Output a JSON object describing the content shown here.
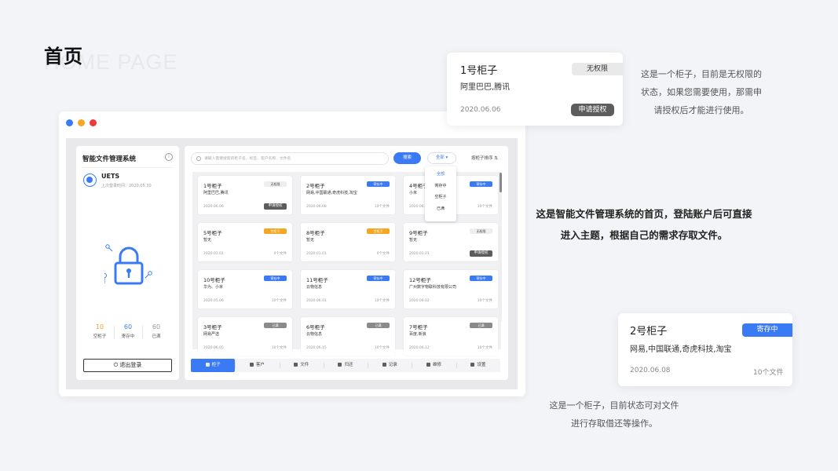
{
  "header": {
    "title": "首页",
    "watermark": "HOME PAGE"
  },
  "sidebar": {
    "app_title": "智能文件管理系统",
    "user": "UETS",
    "last_login": "上次登录时间：2020.05.30",
    "stats": [
      {
        "value": "10",
        "label": "空柜子",
        "color": "#f5a623"
      },
      {
        "value": "60",
        "label": "寄存中",
        "color": "#3a7bf5"
      },
      {
        "value": "60",
        "label": "已满",
        "color": "#999999"
      }
    ],
    "logout_label": "退出登录"
  },
  "toolbar": {
    "search_placeholder": "请输入需要搜索的柜子名、标签、客户名称、文件名",
    "search_button": "搜索",
    "filter_label": "全部",
    "filter_options": [
      "全部",
      "寄存中",
      "空柜子",
      "已满"
    ],
    "sort_label": "按柜子排序"
  },
  "cabinets": [
    {
      "name": "1号柜子",
      "tag": "无权限",
      "tag_style": "none",
      "company": "阿里巴巴,腾讯",
      "date": "2020.06.06",
      "right": "申请授权",
      "right_is_button": true
    },
    {
      "name": "2号柜子",
      "tag": "寄存中",
      "tag_style": "blue",
      "company": "网易,中国联通,奇虎科技,淘宝",
      "date": "2020.06.08",
      "right": "10个文件",
      "right_is_button": false
    },
    {
      "name": "4号柜子",
      "tag": "寄存中",
      "tag_style": "blue",
      "company": "小米",
      "date": "2020.06.04",
      "right": "10个文件",
      "right_is_button": false
    },
    {
      "name": "5号柜子",
      "tag": "空柜子",
      "tag_style": "orange",
      "company": "暂无",
      "date": "2020.01.01",
      "right": "0个文件",
      "right_is_button": false
    },
    {
      "name": "8号柜子",
      "tag": "空柜子",
      "tag_style": "orange",
      "company": "暂无",
      "date": "2020.01.01",
      "right": "0个文件",
      "right_is_button": false
    },
    {
      "name": "9号柜子",
      "tag": "无权限",
      "tag_style": "none",
      "company": "暂无",
      "date": "2020.01.01",
      "right": "申请授权",
      "right_is_button": true
    },
    {
      "name": "10号柜子",
      "tag": "寄存中",
      "tag_style": "blue",
      "company": "华为、小米",
      "date": "2020.05.06",
      "right": "10个文件",
      "right_is_button": false
    },
    {
      "name": "11号柜子",
      "tag": "寄存中",
      "tag_style": "blue",
      "company": "云物信息",
      "date": "2020.06.01",
      "right": "10个文件",
      "right_is_button": false
    },
    {
      "name": "12号柜子",
      "tag": "寄存中",
      "tag_style": "blue",
      "company": "广州数字物联科技有限公司",
      "date": "2020.06.02",
      "right": "10个文件",
      "right_is_button": false
    },
    {
      "name": "3号柜子",
      "tag": "已满",
      "tag_style": "gray",
      "company": "网易严选",
      "date": "2020.06.05",
      "right": "10个文件",
      "right_is_button": false
    },
    {
      "name": "6号柜子",
      "tag": "已满",
      "tag_style": "gray",
      "company": "云物信息",
      "date": "2020.06.15",
      "right": "10个文件",
      "right_is_button": false
    },
    {
      "name": "7号柜子",
      "tag": "已满",
      "tag_style": "gray",
      "company": "百度,新浪",
      "date": "2020.06.12",
      "right": "10个文件",
      "right_is_button": false
    }
  ],
  "tabs": [
    {
      "label": "柜子",
      "icon": "cabinet-icon",
      "active": true
    },
    {
      "label": "客户",
      "icon": "user-icon",
      "active": false
    },
    {
      "label": "文件",
      "icon": "folder-icon",
      "active": false
    },
    {
      "label": "归还",
      "icon": "return-icon",
      "active": false
    },
    {
      "label": "记录",
      "icon": "record-icon",
      "active": false
    },
    {
      "label": "维修",
      "icon": "wrench-icon",
      "active": false
    },
    {
      "label": "设置",
      "icon": "gear-icon",
      "active": false
    }
  ],
  "callouts": {
    "card1": {
      "name": "1号柜子",
      "tag": "无权限",
      "company": "阿里巴巴,腾讯",
      "date": "2020.06.06",
      "button": "申请授权"
    },
    "card1_desc": "这是一个柜子，目前是无权限的状态，如果您需要使用，那需申请授权后才能进行使用。",
    "headline": "这是智能文件管理系统的首页，登陆账户后可直接进入主题，根据自己的需求存取文件。",
    "card2": {
      "name": "2号柜子",
      "tag": "寄存中",
      "company": "网易,中国联通,奇虎科技,淘宝",
      "date": "2020.06.08",
      "files": "10个文件"
    },
    "card2_desc": "这是一个柜子，目前状态可对文件进行存取借还等操作。"
  },
  "colors": {
    "accent": "#3a7bf5",
    "empty": "#f5a623",
    "full": "#8a8a8a",
    "background": "#f3f4f7"
  }
}
